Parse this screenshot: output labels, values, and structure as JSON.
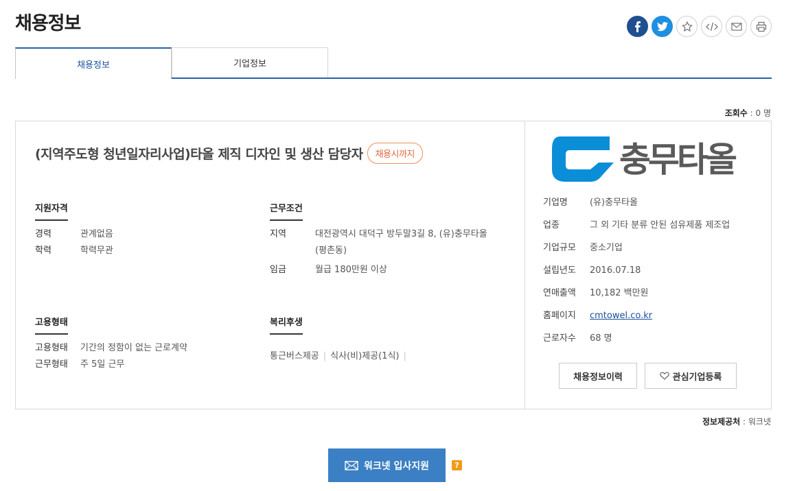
{
  "page": {
    "title": "채용정보"
  },
  "share": {
    "icons": [
      "facebook-icon",
      "twitter-icon",
      "star-icon",
      "embed-icon",
      "email-icon",
      "print-icon"
    ]
  },
  "tabs": [
    {
      "label": "채용정보",
      "active": true
    },
    {
      "label": "기업정보",
      "active": false
    }
  ],
  "views": {
    "label": "조회수",
    "value": ": 0 명"
  },
  "job": {
    "title": "(지역주도형 청년일자리사업)타올 제직 디자인 및 생산 담당자",
    "deadline": "채용시까지",
    "qualification": {
      "title": "지원자격",
      "rows": [
        {
          "k": "경력",
          "v": "관계없음"
        },
        {
          "k": "학력",
          "v": "학력무관"
        }
      ]
    },
    "conditions": {
      "title": "근무조건",
      "rows": [
        {
          "k": "지역",
          "v": "대전광역시 대덕구 방두말3길 8, (유)충무타올",
          "v2": "(평촌동)"
        },
        {
          "k": "임금",
          "v": "월급 180만원 이상"
        }
      ]
    },
    "employment": {
      "title": "고용형태",
      "rows": [
        {
          "k": "고용형태",
          "v": "기간의 정함이 없는 근로계약"
        },
        {
          "k": "근무형태",
          "v": "주 5일 근무"
        }
      ]
    },
    "benefits": {
      "title": "복리후생",
      "items": [
        "통근버스제공",
        "식사(비)제공(1식)"
      ],
      "separator": "|"
    }
  },
  "company": {
    "logo_text": "충무타올",
    "rows": [
      {
        "k": "기업명",
        "v": "(유)충무타올"
      },
      {
        "k": "업종",
        "v": "그 외 기타 분류 안된 섬유제품 제조업"
      },
      {
        "k": "기업규모",
        "v": "중소기업"
      },
      {
        "k": "설립년도",
        "v": "2016.07.18"
      },
      {
        "k": "연매출액",
        "v": "10,182 백만원"
      },
      {
        "k": "홈페이지",
        "v": "cmtowel.co.kr"
      },
      {
        "k": "근로자수",
        "v": "68 명"
      }
    ],
    "history_button": "채용정보이력",
    "favorite_button": "관심기업등록"
  },
  "provider": {
    "label": "정보제공처",
    "value": ": 워크넷"
  },
  "apply": {
    "label": "워크넷 입사지원",
    "help": "?"
  },
  "colors": {
    "accent": "#2663a9",
    "apply_bg": "#3b7fc4",
    "deadline": "#e0693a",
    "logo_blue": "#0b8ed8",
    "logo_gray": "#5a5a5a"
  }
}
